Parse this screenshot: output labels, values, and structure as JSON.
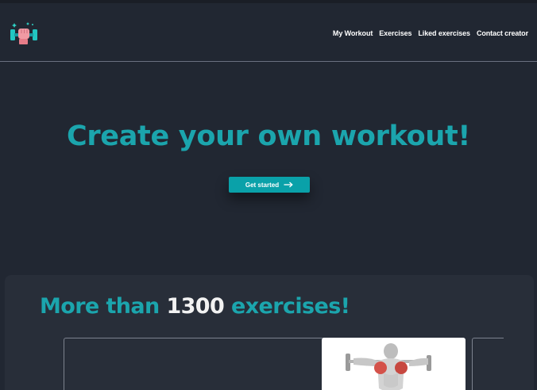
{
  "brand": {
    "logo_icon": "dumbbell-fist-icon"
  },
  "nav": {
    "items": [
      {
        "label": "My Workout"
      },
      {
        "label": "Exercises"
      },
      {
        "label": "Liked exercises"
      },
      {
        "label": "Contact creator"
      }
    ]
  },
  "hero": {
    "title": "Create your own workout!",
    "cta_label": "Get started",
    "cta_icon": "arrow-right-icon"
  },
  "exercises_section": {
    "title_prefix": "More than",
    "title_count": "1300",
    "title_suffix": "exercises!"
  },
  "colors": {
    "background": "#212732",
    "accent": "#1ba5ad",
    "button": "#0aa1a9",
    "panel": "#282e39"
  }
}
